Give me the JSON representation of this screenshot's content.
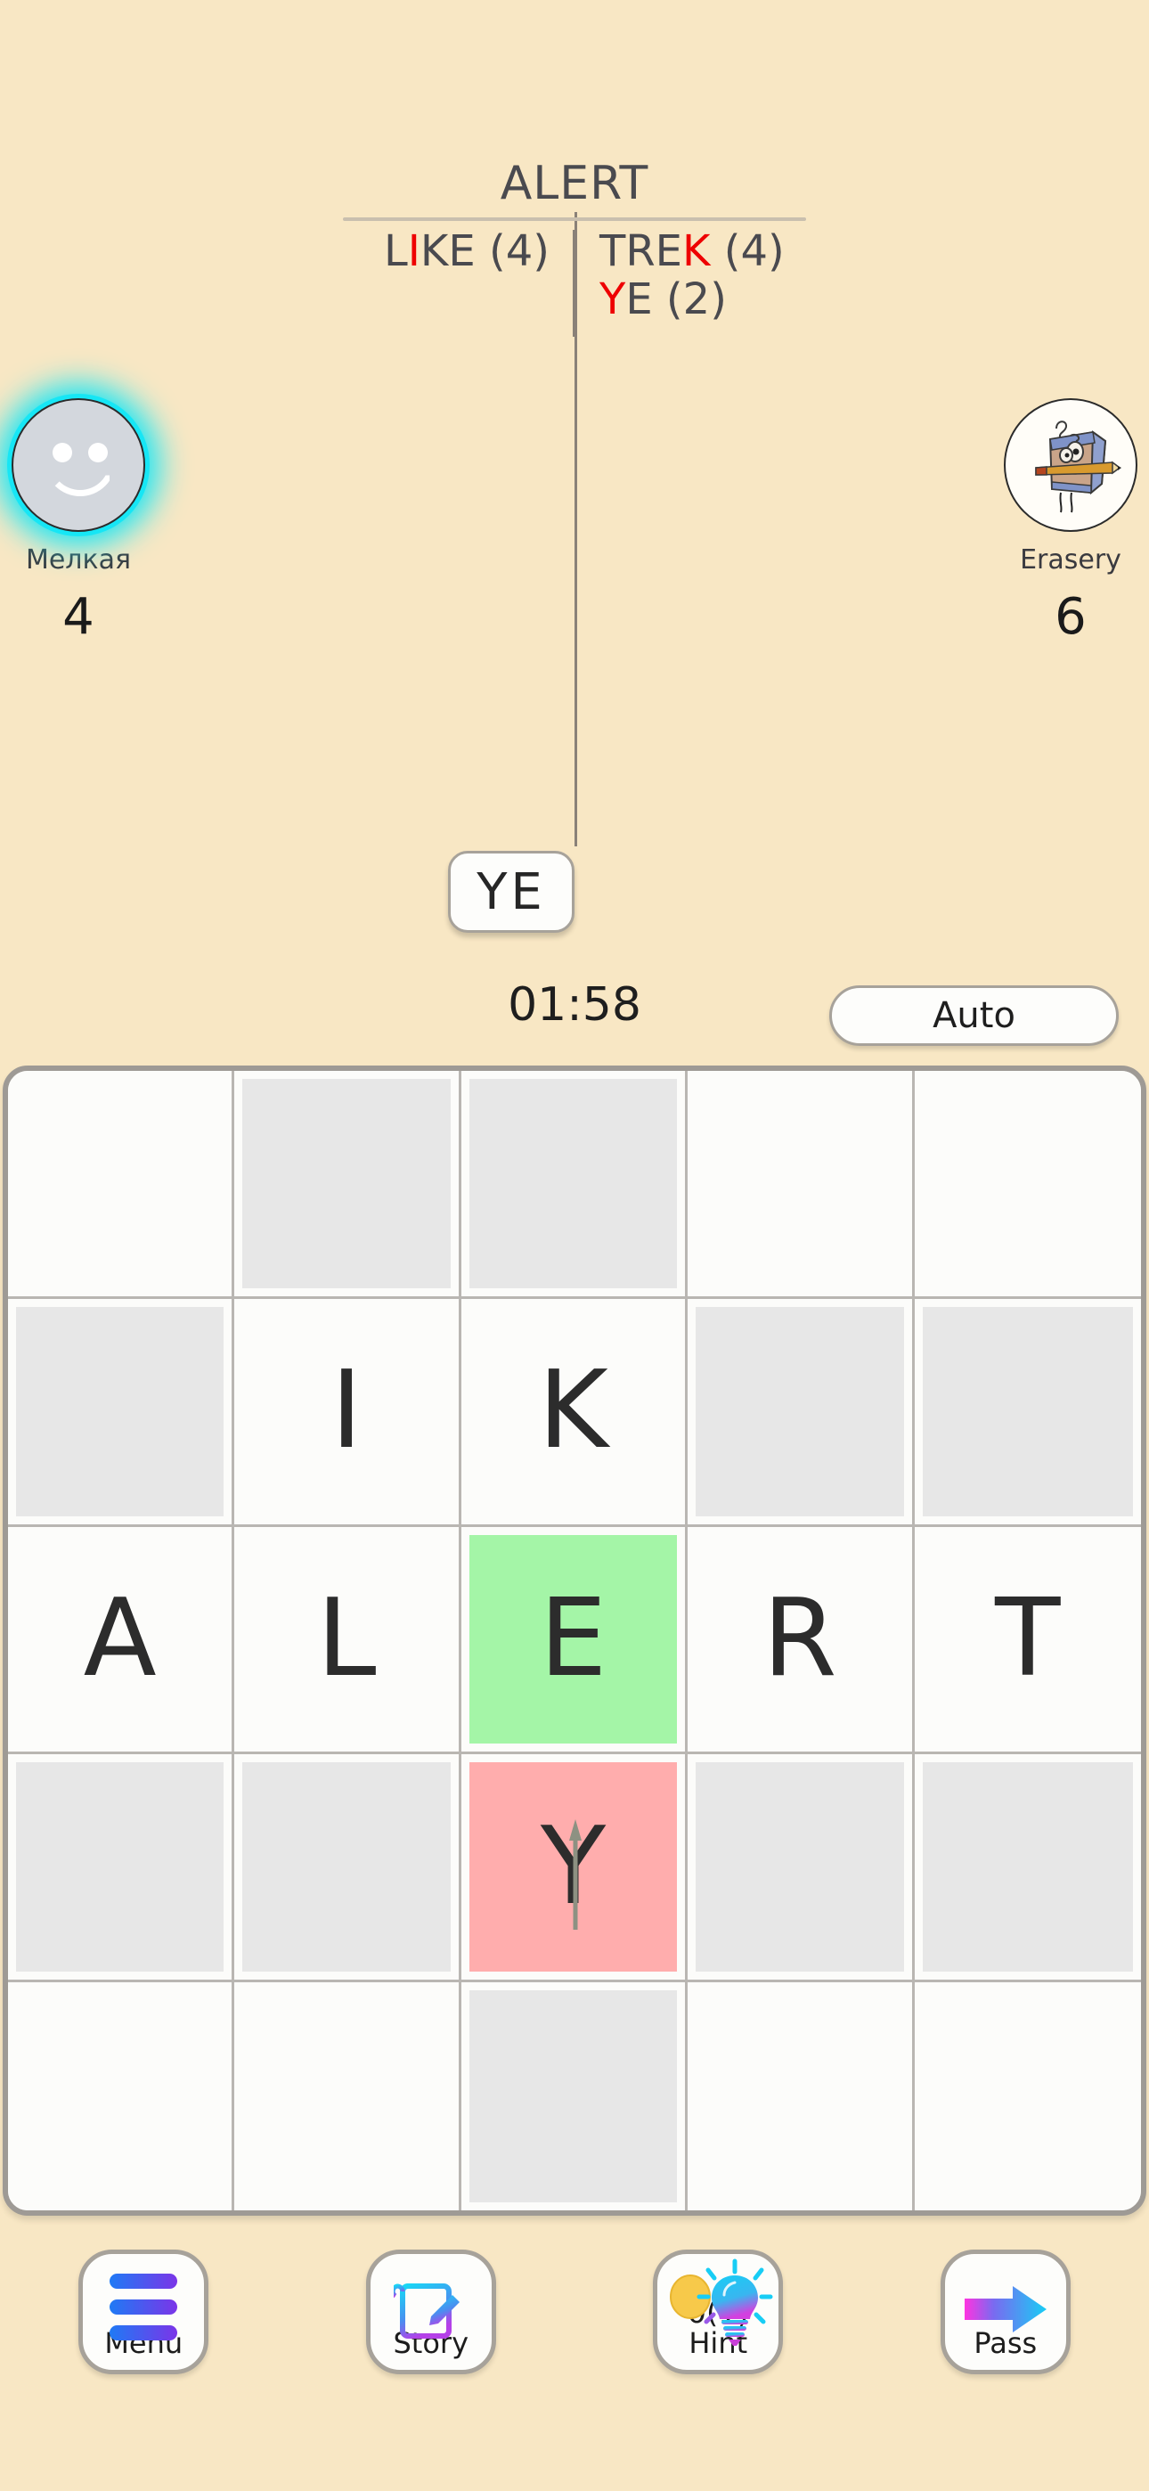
{
  "header": {
    "main_word": "ALERT",
    "left_word": {
      "prefix": "L",
      "highlight": "I",
      "suffix": "KE",
      "count": "(4)"
    },
    "right_word_1": {
      "prefix": "TRE",
      "highlight": "K",
      "suffix": "",
      "count": "(4)"
    },
    "right_word_2": {
      "prefix": "",
      "highlight": "Y",
      "suffix": "E",
      "count": "(2)"
    },
    "highlight_color": "#ee0000",
    "rule_color": "#c9bfae"
  },
  "players": {
    "left": {
      "name": "Мелкая",
      "score": "4",
      "avatar_icon": "smiley-face-avatar",
      "active": true,
      "glow_color": "#16e6f5"
    },
    "right": {
      "name": "Erasery",
      "score": "6",
      "avatar_icon": "eraser-character-avatar",
      "active": false
    }
  },
  "current_tile": {
    "letters": "YE"
  },
  "timer": {
    "value": "01:58"
  },
  "auto_button": {
    "label": "Auto"
  },
  "board": {
    "rows": 5,
    "cols": 5,
    "cells": [
      [
        {
          "letter": "",
          "state": "empty"
        },
        {
          "letter": "",
          "state": "blocked"
        },
        {
          "letter": "",
          "state": "blocked"
        },
        {
          "letter": "",
          "state": "empty"
        },
        {
          "letter": "",
          "state": "empty"
        }
      ],
      [
        {
          "letter": "",
          "state": "blocked"
        },
        {
          "letter": "I",
          "state": "empty"
        },
        {
          "letter": "K",
          "state": "empty"
        },
        {
          "letter": "",
          "state": "blocked"
        },
        {
          "letter": "",
          "state": "blocked"
        }
      ],
      [
        {
          "letter": "A",
          "state": "empty"
        },
        {
          "letter": "L",
          "state": "empty"
        },
        {
          "letter": "E",
          "state": "green"
        },
        {
          "letter": "R",
          "state": "empty"
        },
        {
          "letter": "T",
          "state": "empty"
        }
      ],
      [
        {
          "letter": "",
          "state": "blocked"
        },
        {
          "letter": "",
          "state": "blocked"
        },
        {
          "letter": "Y",
          "state": "red"
        },
        {
          "letter": "",
          "state": "blocked"
        },
        {
          "letter": "",
          "state": "blocked"
        }
      ],
      [
        {
          "letter": "",
          "state": "empty"
        },
        {
          "letter": "",
          "state": "empty"
        },
        {
          "letter": "",
          "state": "blocked"
        },
        {
          "letter": "",
          "state": "empty"
        },
        {
          "letter": "",
          "state": "empty"
        }
      ]
    ],
    "colors": {
      "green_cell": "#a4f5a7",
      "red_cell": "#ffadad",
      "blocked_cell": "#e7e7e7",
      "empty_cell": "#fcfcfa",
      "grid_line": "#b9b6b2",
      "border": "#9e9a95"
    },
    "move_arrow": {
      "icon": "up-arrow-icon",
      "color": "#8d9182"
    }
  },
  "bottom_bar": {
    "menu": {
      "label": "Menu",
      "icon": "hamburger-menu-icon"
    },
    "story": {
      "label": "Story",
      "icon": "document-pencil-icon"
    },
    "hint": {
      "count": "0(1)",
      "label": "Hint",
      "icon": "lightbulb-icon",
      "coin_icon": "coin-icon"
    },
    "pass": {
      "label": "Pass",
      "icon": "right-arrow-icon"
    }
  },
  "theme": {
    "background": "#f8e7c4",
    "text": "#2c2c2c"
  }
}
